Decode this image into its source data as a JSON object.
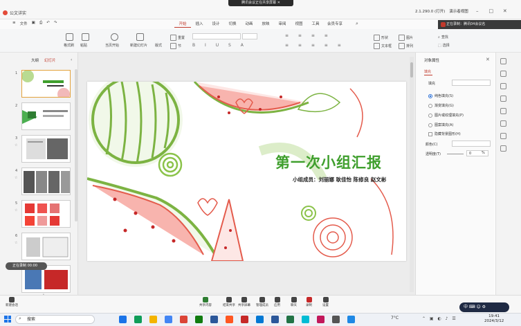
{
  "meeting_banner": "腾讯会议正在共享屏幕 ✕",
  "doc_tab": "公文详实",
  "title_right": {
    "zoom": "2.1.290.0 (打开)",
    "share": "演示者视图"
  },
  "menu": {
    "file": "文件"
  },
  "ribbon_tabs": [
    "开始",
    "插入",
    "设计",
    "切换",
    "动画",
    "放映",
    "审阅",
    "视图",
    "工具",
    "会员专享"
  ],
  "active_tab": "开始",
  "notification": "正在录制：腾讯04会议名",
  "toolbar": {
    "format_painter": "格式刷",
    "paste": "粘贴",
    "play_from_current": "当页开始",
    "new_slide": "新建幻灯片",
    "layout": "版式",
    "section": "节",
    "reset": "重置",
    "shape": "形状",
    "text_box": "文本框",
    "picture": "图片",
    "arrange": "排列",
    "find": "查找",
    "select": "选择"
  },
  "panel_tabs": {
    "outline": "大纲",
    "slides": "幻灯片"
  },
  "slide_numbers": [
    "1",
    "2",
    "3",
    "4",
    "5",
    "6",
    "7"
  ],
  "recording_float": "正在录制 00:00",
  "slide": {
    "title": "第一次小组汇报",
    "members": "小组成员：刘丽娜 耿佳怡 陈修良 赵文彬"
  },
  "pane": {
    "title": "对象属性",
    "tab": "填充",
    "fill_label": "填充",
    "options": [
      "纯色填充(S)",
      "渐变填充(G)",
      "图片或纹理填充(P)",
      "图案填充(A)"
    ],
    "hide_bg": "隐藏背景图形(H)",
    "color_label": "颜色(C)",
    "transparency_label": "透明度(T)",
    "transparency_value": "0",
    "unit": "%"
  },
  "meeting_bar": [
    "新建会话",
    "共享内容",
    "结束共享",
    "共享屏幕",
    "管理成员",
    "应用",
    "聊天",
    "录制",
    "表情",
    "设置",
    "更多"
  ],
  "ime": "中 ⌨ ☺ ⚙",
  "taskbar": {
    "search": "搜索",
    "weather": "7°C",
    "time": "19:41",
    "date": "2024/3/12"
  }
}
